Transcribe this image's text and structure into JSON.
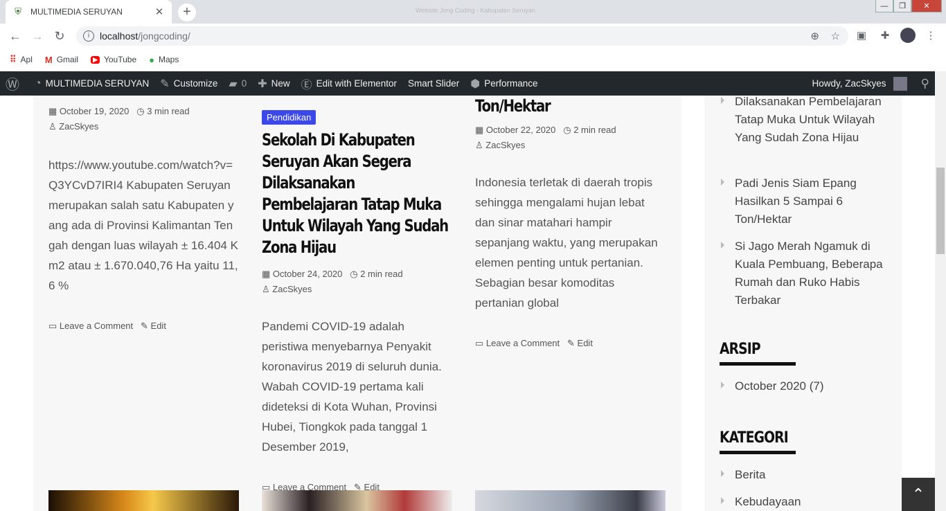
{
  "browser": {
    "tab_title": "MULTIMEDIA SERUYAN",
    "window_title": "Website Jong Coding - Kabupaten Seruyan",
    "url_host": "localhost",
    "url_path": "/jongcoding/",
    "bookmarks": [
      {
        "label": "Apl",
        "icon": "apps-grid-icon"
      },
      {
        "label": "Gmail",
        "icon": "gmail-icon"
      },
      {
        "label": "YouTube",
        "icon": "youtube-icon"
      },
      {
        "label": "Maps",
        "icon": "maps-pin-icon"
      }
    ]
  },
  "adminbar": {
    "site_name": "MULTIMEDIA SERUYAN",
    "customize": "Customize",
    "comments_count": "0",
    "new_label": "New",
    "elementor": "Edit with Elementor",
    "smart_slider": "Smart Slider",
    "performance": "Performance",
    "howdy": "Howdy, ZacSkyes"
  },
  "posts": [
    {
      "date": "October 19, 2020",
      "read": "3 min read",
      "author": "ZacSkyes",
      "excerpt": "https://www.youtube.com/watch?v=Q3YCvD7IRI4 Kabupaten Seruyan merupakan salah satu Kabupaten yang ada di Provinsi Kalimantan Tengah dengan luas wilayah ± 16.404 Km2 atau ± 1.670.040,76 Ha yaitu 11,6 %",
      "comment": "Leave a Comment",
      "edit": "Edit"
    },
    {
      "category": "Pendidikan",
      "title": "Sekolah Di Kabupaten Seruyan Akan Segera Dilaksanakan Pembelajaran Tatap Muka Untuk Wilayah Yang Sudah Zona Hijau",
      "date": "October 24, 2020",
      "read": "2 min read",
      "author": "ZacSkyes",
      "excerpt": "Pandemi COVID-19 adalah peristiwa menyebarnya Penyakit koronavirus 2019 di seluruh dunia. Wabah COVID-19 pertama kali dideteksi di Kota Wuhan, Provinsi Hubei, Tiongkok pada tanggal 1 Desember 2019,",
      "comment": "Leave a Comment",
      "edit": "Edit"
    },
    {
      "title_tail": "Ton/Hektar",
      "date": "October 22, 2020",
      "read": "2 min read",
      "author": "ZacSkyes",
      "excerpt": "Indonesia terletak di daerah tropis sehingga mengalami hujan lebat dan sinar matahari hampir sepanjang waktu, yang merupakan elemen penting untuk pertanian. Sebagian besar komoditas pertanian global",
      "comment": "Leave a Comment",
      "edit": "Edit"
    }
  ],
  "sidebar": {
    "recent_partial": "Dilaksanakan Pembelajaran Tatap Muka Untuk Wilayah Yang Sudah Zona Hijau",
    "recent": [
      "Padi Jenis Siam Epang Hasilkan 5 Sampai 6 Ton/Hektar",
      "Si Jago Merah Ngamuk di Kuala Pembuang, Beberapa Rumah dan Ruko Habis Terbakar"
    ],
    "archive_title": "ARSIP",
    "archive_items": [
      "October 2020 (7)"
    ],
    "category_title": "KATEGORI",
    "category_items": [
      "Berita",
      "Kebudayaan"
    ]
  }
}
